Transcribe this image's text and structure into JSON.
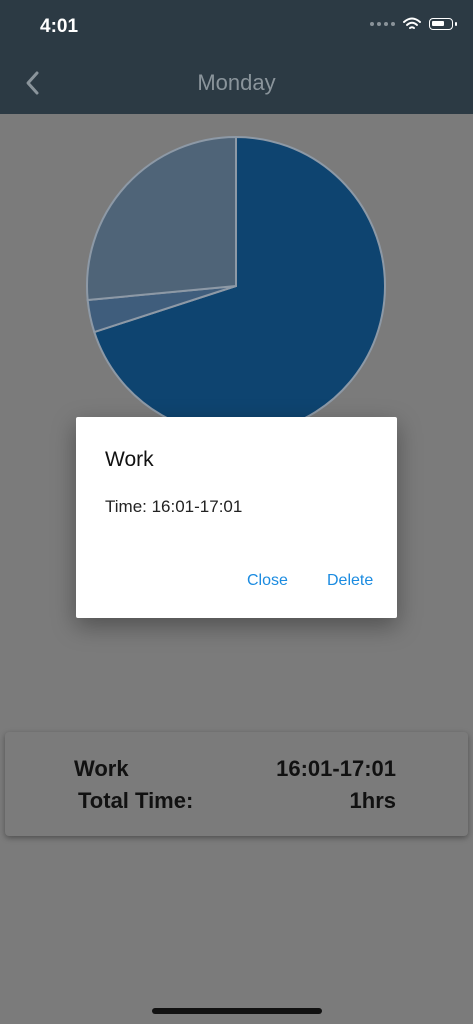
{
  "status_bar": {
    "time": "4:01"
  },
  "nav": {
    "title": "Monday",
    "back_icon": "chevron-left-icon"
  },
  "chart_data": {
    "type": "pie",
    "slices": [
      {
        "value": 70.0,
        "color": "#0e4470"
      },
      {
        "value": 3.5,
        "color": "#3f5d7c"
      },
      {
        "value": 26.5,
        "color": "#4f6478"
      }
    ]
  },
  "dialog": {
    "title": "Work",
    "message": "Time: 16:01-17:01",
    "close_label": "Close",
    "delete_label": "Delete",
    "button_color": "#1b8be0"
  },
  "summary": {
    "activity_label": "Work",
    "activity_time": "16:01-17:01",
    "total_label": "Total Time:",
    "total_value": "1hrs"
  }
}
